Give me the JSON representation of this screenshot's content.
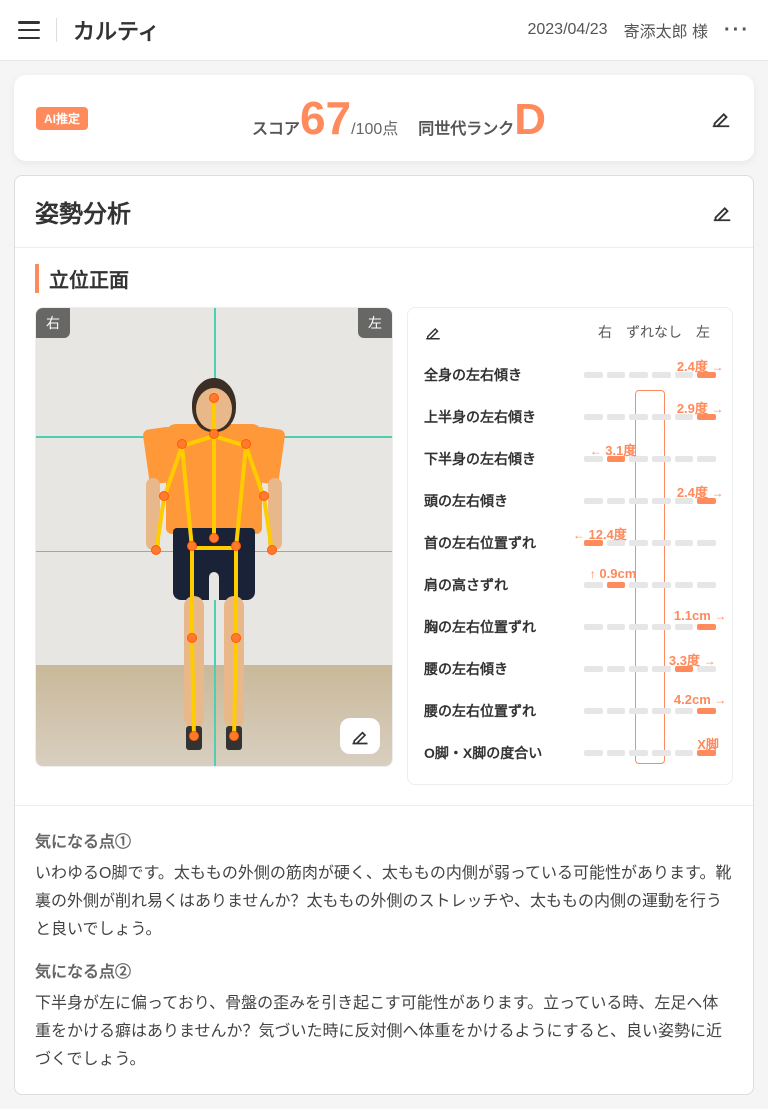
{
  "header": {
    "app_name": "カルティ",
    "date": "2023/04/23",
    "patient": "寄添太郎 様"
  },
  "score": {
    "ai_badge": "AI推定",
    "score_label": "スコア",
    "score_value": "67",
    "score_max": "/100点",
    "rank_label": "同世代ランク",
    "rank_value": "D"
  },
  "analysis": {
    "title": "姿勢分析",
    "sub_title": "立位正面",
    "photo": {
      "right_tag": "右",
      "left_tag": "左"
    },
    "metrics_header": {
      "right": "右",
      "center": "ずれなし",
      "left": "左"
    },
    "metrics": [
      {
        "name": "全身の左右傾き",
        "value": "2.4度",
        "pos": 88,
        "dir": "→"
      },
      {
        "name": "上半身の左右傾き",
        "value": "2.9度",
        "pos": 88,
        "dir": "→"
      },
      {
        "name": "下半身の左右傾き",
        "value": "3.1度",
        "pos": 22,
        "dir": "←"
      },
      {
        "name": "頭の左右傾き",
        "value": "2.4度",
        "pos": 88,
        "dir": "→"
      },
      {
        "name": "首の左右位置ずれ",
        "value": "12.4度",
        "pos": 12,
        "dir": "←"
      },
      {
        "name": "肩の高さずれ",
        "value": "0.9cm",
        "pos": 22,
        "dir": "↑"
      },
      {
        "name": "胸の左右位置ずれ",
        "value": "1.1cm",
        "pos": 88,
        "dir": "→"
      },
      {
        "name": "腰の左右傾き",
        "value": "3.3度",
        "pos": 82,
        "dir": "→"
      },
      {
        "name": "腰の左右位置ずれ",
        "value": "4.2cm",
        "pos": 88,
        "dir": "→"
      },
      {
        "name": "O脚・X脚の度合い",
        "value": "X脚",
        "pos": 94,
        "dir": ""
      }
    ],
    "notes": [
      {
        "title": "気になる点①",
        "body": "いわゆるO脚です。太ももの外側の筋肉が硬く、太ももの内側が弱っている可能性があります。靴裏の外側が削れ易くはありませんか？太ももの外側のストレッチや、太ももの内側の運動を行うと良いでしょう。"
      },
      {
        "title": "気になる点②",
        "body": "下半身が左に偏っており、骨盤の歪みを引き起こす可能性があります。立っている時、左足へ体重をかける癖はありませんか？気づいた時に反対側へ体重をかけるようにすると、良い姿勢に近づくでしょう。"
      }
    ]
  }
}
